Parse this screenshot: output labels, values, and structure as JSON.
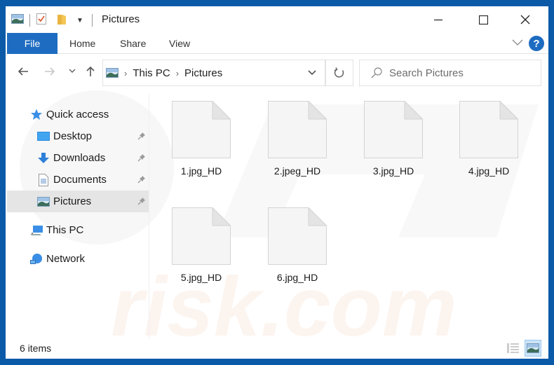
{
  "window": {
    "title": "Pictures",
    "controls": {
      "minimize": "minimize",
      "maximize": "maximize",
      "close": "close"
    }
  },
  "ribbon": {
    "tabs": [
      {
        "label": "File",
        "active": true
      },
      {
        "label": "Home"
      },
      {
        "label": "Share"
      },
      {
        "label": "View"
      }
    ],
    "help_label": "?"
  },
  "address": {
    "crumbs": [
      "This PC",
      "Pictures"
    ],
    "search_placeholder": "Search Pictures"
  },
  "navpane": {
    "quick_access": "Quick access",
    "items": [
      {
        "label": "Desktop",
        "icon": "desktop-icon",
        "pinned": true
      },
      {
        "label": "Downloads",
        "icon": "downloads-icon",
        "pinned": true
      },
      {
        "label": "Documents",
        "icon": "documents-icon",
        "pinned": true
      },
      {
        "label": "Pictures",
        "icon": "pictures-icon",
        "pinned": true,
        "selected": true
      }
    ],
    "this_pc": "This PC",
    "network": "Network"
  },
  "files": [
    {
      "name": "1.jpg_HD"
    },
    {
      "name": "2.jpeg_HD"
    },
    {
      "name": "3.jpg_HD"
    },
    {
      "name": "4.jpg_HD"
    },
    {
      "name": "5.jpg_HD"
    },
    {
      "name": "6.jpg_HD"
    }
  ],
  "status": {
    "item_count": "6 items",
    "active_view": "large-icons"
  },
  "colors": {
    "frame": "#0b5aa8",
    "accent": "#1e6cc1",
    "selected_bg": "#e5e5e5"
  }
}
